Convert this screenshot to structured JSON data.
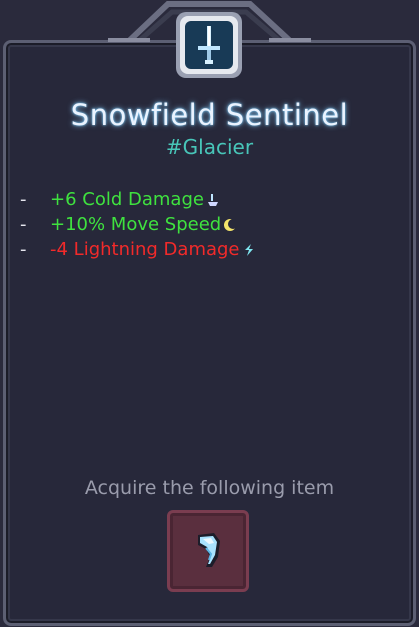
{
  "item": {
    "name": "Snowfield Sentinel",
    "tag": "#Glacier"
  },
  "stats": [
    {
      "dash": "-",
      "text": "+6 Cold Damage",
      "type": "positive",
      "icon": "cold-drop-icon"
    },
    {
      "dash": "-",
      "text": "+10% Move Speed",
      "type": "positive",
      "icon": "speed-moon-icon"
    },
    {
      "dash": "-",
      "text": "-4 Lightning Damage",
      "type": "negative",
      "icon": "lightning-icon"
    }
  ],
  "acquire": {
    "label": "Acquire the following item",
    "item_icon": "ice-fang-icon"
  },
  "colors": {
    "positive": "#3fe23f",
    "negative": "#f22a2a",
    "title_glow": "#7bd0ff",
    "tag": "#48c6b9"
  }
}
